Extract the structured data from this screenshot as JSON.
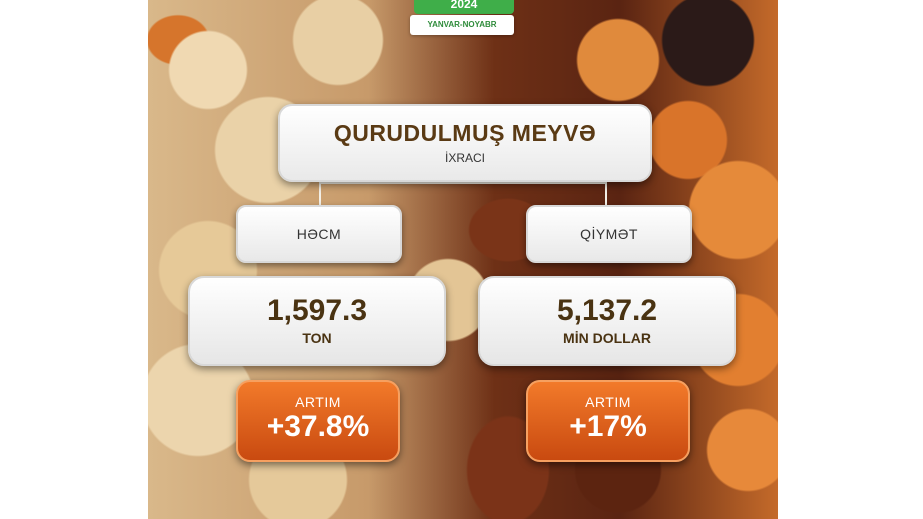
{
  "header": {
    "year": "2024",
    "period": "YANVAR-NOYABR"
  },
  "title": {
    "main": "QURUDULMUŞ MEYVƏ",
    "sub": "İXRACI"
  },
  "volume": {
    "label": "HƏCM",
    "value": "1,597.3",
    "unit": "TON",
    "growth_label": "ARTIM",
    "growth_value": "+37.8%"
  },
  "price": {
    "label": "QİYMƏT",
    "value": "5,137.2",
    "unit": "MİN DOLLAR",
    "growth_label": "ARTIM",
    "growth_value": "+17%"
  },
  "colors": {
    "brand_green": "#3fae49",
    "text_brown": "#4a3312",
    "growth_orange": "#e5631c"
  }
}
